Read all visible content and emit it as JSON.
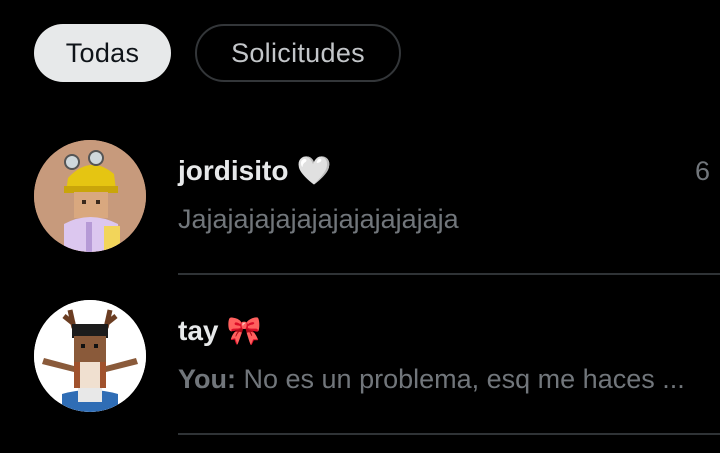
{
  "filters": {
    "all_label": "Todas",
    "requests_label": "Solicitudes"
  },
  "conversations": [
    {
      "name": "jordisito",
      "emoji": "🤍",
      "time": "6",
      "preview_prefix": "",
      "preview": "Jajajajajajajajajajajajaja"
    },
    {
      "name": "tay",
      "emoji": "🎀",
      "time": "",
      "preview_prefix": "You:",
      "preview": "No es un problema, esq me haces ..."
    }
  ]
}
